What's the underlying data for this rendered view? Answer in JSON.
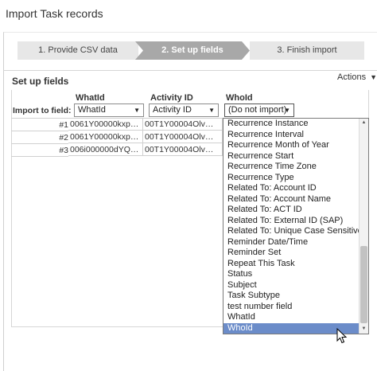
{
  "title": "Import Task records",
  "wizard": {
    "steps": [
      "1. Provide CSV data",
      "2. Set up fields",
      "3. Finish import"
    ],
    "active_step": 2
  },
  "panel": {
    "title": "Set up fields",
    "actions_label": "Actions"
  },
  "mapping": {
    "import_to_field_label": "Import to field:",
    "columns": [
      {
        "header": "WhatId",
        "selected": "WhatId"
      },
      {
        "header": "Activity ID",
        "selected": "Activity ID"
      },
      {
        "header": "WhoId",
        "selected": "(Do not import)"
      }
    ],
    "rows": [
      {
        "num": "#1",
        "cells": [
          "0061Y00000kxp…",
          "00T1Y00004Olv…"
        ]
      },
      {
        "num": "#2",
        "cells": [
          "0061Y00000kxp…",
          "00T1Y00004Olv…"
        ]
      },
      {
        "num": "#3",
        "cells": [
          "006i000000dYQ…",
          "00T1Y00004Olv…"
        ]
      }
    ]
  },
  "dropdown": {
    "options": [
      "Recurrence Instance",
      "Recurrence Interval",
      "Recurrence Month of Year",
      "Recurrence Start",
      "Recurrence Time Zone",
      "Recurrence Type",
      "Related To: Account ID",
      "Related To: Account Name",
      "Related To: ACT ID",
      "Related To: External ID (SAP)",
      "Related To: Unique Case Sensitive",
      "Reminder Date/Time",
      "Reminder Set",
      "Repeat This Task",
      "Status",
      "Subject",
      "Task Subtype",
      "test number field",
      "WhatId",
      "WhoId"
    ],
    "highlighted": "WhoId",
    "accent": "#6b8cc9"
  }
}
